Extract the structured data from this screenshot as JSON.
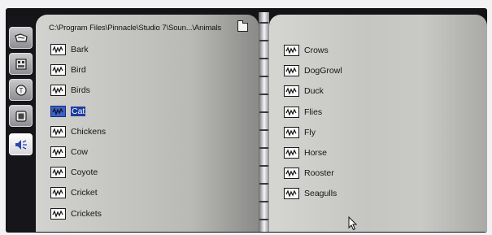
{
  "browser": {
    "path": "C:\\Program Files\\Pinnacle\\Studio 7\\Soun...\\Animals"
  },
  "tabs": [
    {
      "icon": "video-tab-icon"
    },
    {
      "icon": "image-tab-icon"
    },
    {
      "icon": "title-tab-icon"
    },
    {
      "icon": "photo-tab-icon"
    },
    {
      "icon": "sound-tab-icon",
      "active": true
    }
  ],
  "left_items": [
    {
      "label": "Bark"
    },
    {
      "label": "Bird"
    },
    {
      "label": "Birds"
    },
    {
      "label": "Cat",
      "selected": true
    },
    {
      "label": "Chickens"
    },
    {
      "label": "Cow"
    },
    {
      "label": "Coyote"
    },
    {
      "label": "Cricket"
    },
    {
      "label": "Crickets"
    }
  ],
  "right_items": [
    {
      "label": "Crows"
    },
    {
      "label": "DogGrowl"
    },
    {
      "label": "Duck"
    },
    {
      "label": "Flies"
    },
    {
      "label": "Fly"
    },
    {
      "label": "Horse"
    },
    {
      "label": "Rooster"
    },
    {
      "label": "Seagulls"
    }
  ],
  "colors": {
    "selection": "#203ca0",
    "frame": "#141417"
  }
}
